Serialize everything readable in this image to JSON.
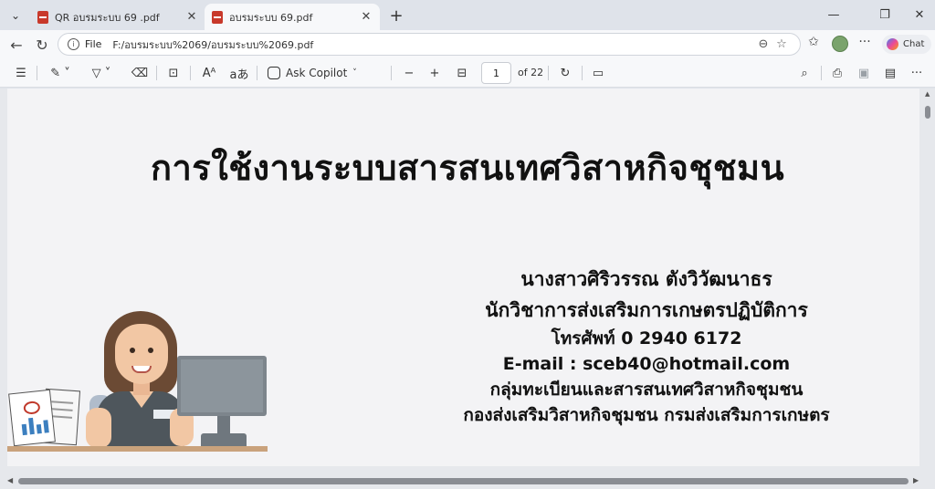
{
  "tabs": [
    {
      "title": "QR อบรมระบบ 69 .pdf",
      "active": false
    },
    {
      "title": "อบรมระบบ 69.pdf",
      "active": true
    }
  ],
  "address": {
    "scheme": "File",
    "url": "F:/อบรมระบบ%2069/อบรมระบบ%2069.pdf"
  },
  "chat_label": "Chat",
  "pdf_toolbar": {
    "ask_copilot": "Ask Copilot",
    "page_current": "1",
    "page_total": "of 22"
  },
  "slide": {
    "title": "การใช้งานระบบสารสนเทศวิสาหกิจชุชมน",
    "lines": [
      "นางสาวศิริวรรณ ตังวิวัฒนาธร",
      "นักวิชาการส่งเสริมการเกษตรปฏิบัติการ",
      "โทรศัพท์ 0 2940 6172",
      "E-mail : sceb40@hotmail.com",
      "กลุ่มทะเบียนและสารสนเทศวิสาหกิจชุมชน",
      "กองส่งเสริมวิสาหกิจชุมชน กรมส่งเสริมการเกษตร"
    ]
  },
  "icons": {
    "tab_list": "chevron-down-icon",
    "pdf": "pdf-file-icon",
    "close": "close-icon",
    "new_tab": "plus-icon",
    "minimize": "minimize-icon",
    "restore": "restore-icon",
    "window_close": "close-icon",
    "back": "arrow-left-icon",
    "refresh": "refresh-icon",
    "info": "info-icon",
    "zoom": "zoom-icon",
    "favorite": "star-icon",
    "favorites": "favorites-icon",
    "copilot": "copilot-icon",
    "contents": "list-icon",
    "draw": "pen-icon",
    "highlight": "highlighter-icon",
    "erase": "eraser-icon",
    "text": "text-box-icon",
    "read_aloud": "read-aloud-icon",
    "translate": "translate-icon",
    "zoom_out": "minus-icon",
    "zoom_in": "plus-icon",
    "fit": "fit-page-icon",
    "rotate": "rotate-icon",
    "page_view": "page-view-icon",
    "search": "search-icon",
    "print": "print-icon",
    "save": "save-icon",
    "save_as": "save-as-icon",
    "more": "more-icon"
  },
  "colors": {
    "tab_strip": "#dfe3ea",
    "toolbar": "#f7f8fa",
    "page": "#f3f3f5",
    "pdf_icon": "#c8392b"
  }
}
